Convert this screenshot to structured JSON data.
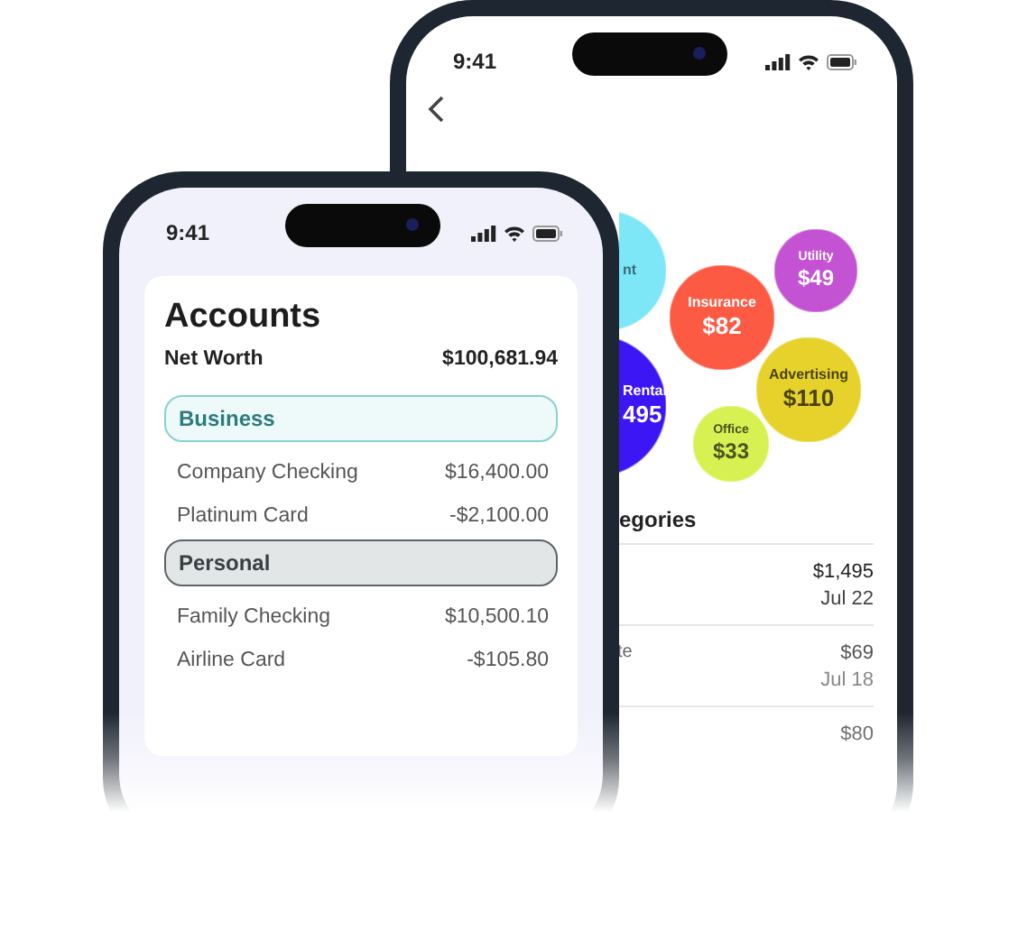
{
  "back_phone": {
    "status_time": "9:41",
    "bubbles": [
      {
        "label": "nt",
        "color": "#7de6f7"
      },
      {
        "label": "Rental",
        "amount": "495",
        "color": "#3d16f5"
      },
      {
        "label": "Insurance",
        "amount": "$82",
        "color": "#fd5a43"
      },
      {
        "label": "Utility",
        "amount": "$49",
        "color": "#c353d3"
      },
      {
        "label": "Advertising",
        "amount": "$110",
        "color": "#e7d22c"
      },
      {
        "label": "Office",
        "amount": "$33",
        "color": "#d8f152"
      }
    ],
    "section_title": "egories",
    "transactions": [
      {
        "amount": "$1,495",
        "date": "Jul 22"
      },
      {
        "name": "te",
        "amount": "$69",
        "date": "Jul 18"
      },
      {
        "amount": "$80"
      }
    ]
  },
  "front_phone": {
    "status_time": "9:41",
    "title": "Accounts",
    "net_worth_label": "Net Worth",
    "net_worth": "$100,681.94",
    "groups": [
      {
        "name": "Business",
        "color": "#8ccfcf",
        "accounts": [
          {
            "name": "Company Checking",
            "amount": "$16,400.00"
          },
          {
            "name": "Platinum Card",
            "amount": "-$2,100.00"
          }
        ]
      },
      {
        "name": "Personal",
        "color": "#5d6366",
        "accounts": [
          {
            "name": "Family Checking",
            "amount": "$10,500.10"
          },
          {
            "name": "Airline Card",
            "amount": "-$105.80"
          }
        ]
      }
    ]
  }
}
